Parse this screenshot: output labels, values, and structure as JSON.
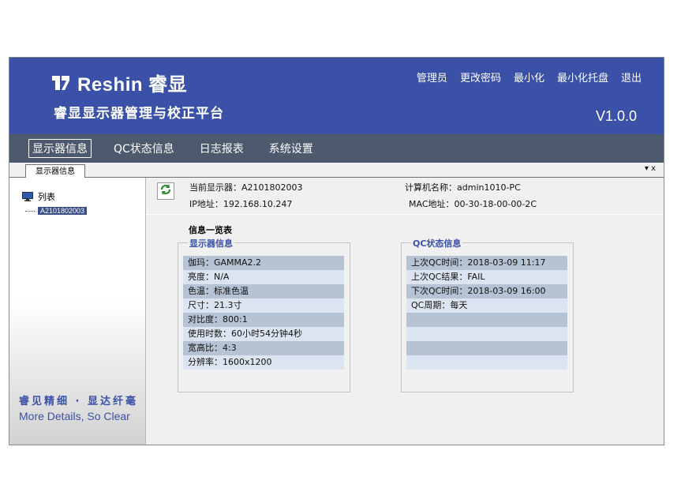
{
  "header": {
    "brand": "Reshin 睿显",
    "platform_title": "睿显显示器管理与校正平台",
    "version": "V1.0.0",
    "menu": [
      "管理员",
      "更改密码",
      "最小化",
      "最小化托盘",
      "退出"
    ]
  },
  "nav": {
    "items": [
      "显示器信息",
      "QC状态信息",
      "日志报表",
      "系统设置"
    ]
  },
  "tab": {
    "label": "显示器信息",
    "controls": "▾ x"
  },
  "sidebar": {
    "root_label": "列表",
    "child_label": "A2101802003",
    "slogan_cn": "睿见精细 · 显达纤毫",
    "slogan_en": "More Details, So Clear"
  },
  "info": {
    "current_display": "当前显示器：A2101802003",
    "ip": "IP地址：192.168.10.247",
    "computer_name": "计算机名称：admin1010-PC",
    "mac": "MAC地址：00-30-18-00-00-2C"
  },
  "list_title": "信息一览表",
  "display_panel": {
    "title": "显示器信息",
    "rows": [
      "伽玛：GAMMA2.2",
      "亮度：N/A",
      "色温：标准色温",
      "尺寸：21.3寸",
      "对比度：800:1",
      "使用时数：60小时54分钟4秒",
      "宽高比：4:3",
      "分辨率：1600x1200"
    ]
  },
  "qc_panel": {
    "title": "QC状态信息",
    "rows": [
      "上次QC时间：2018-03-09  11:17",
      "上次QC结果：FAIL",
      "下次QC时间：2018-03-09  16:00",
      "QC周期：每天",
      "",
      "",
      "",
      ""
    ]
  },
  "colors": {
    "header_bg": "#3a51a7",
    "nav_bg": "#4d5a6e",
    "row_dark": "#b6c3d4",
    "row_light": "#dbe4f0",
    "accent_text": "#3a51a7"
  }
}
